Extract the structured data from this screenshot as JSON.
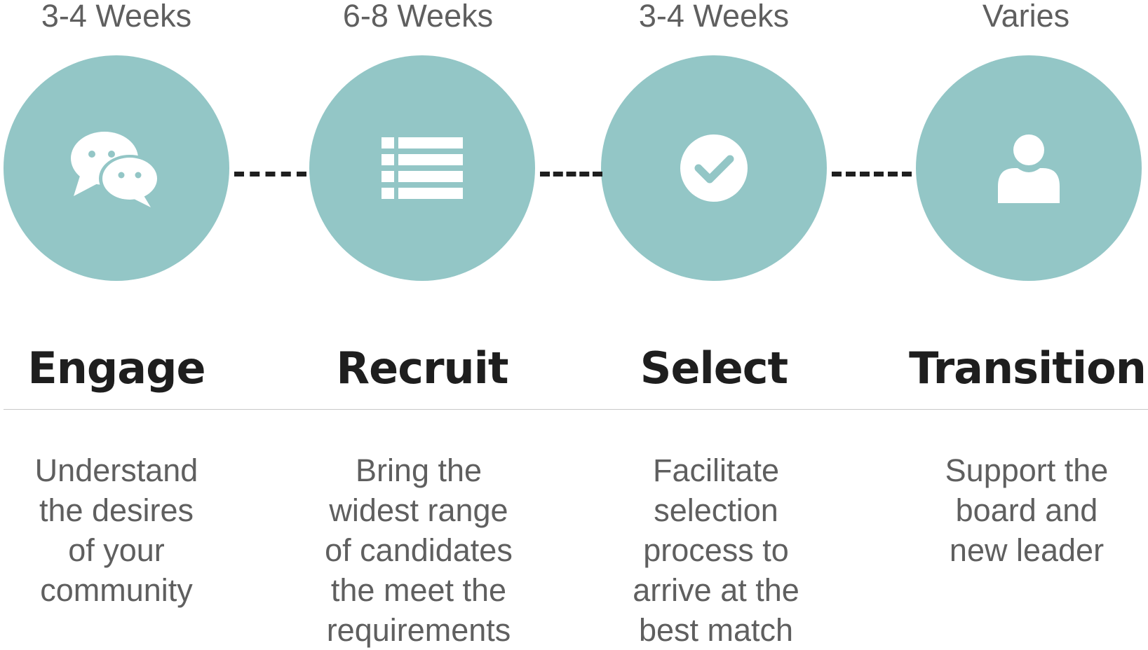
{
  "colors": {
    "circle_fill": "#93c6c6",
    "icon_fill": "#ffffff",
    "connector": "#1f1f1f",
    "duration_text": "#5f5f5f",
    "title_text": "#1e1e1e",
    "description_text": "#5f5f5f"
  },
  "steps": [
    {
      "duration": "3-4 Weeks",
      "icon": "chat-bubbles-icon",
      "title": "Engage",
      "description": "Understand\nthe desires\nof your\ncommunity"
    },
    {
      "duration": "6-8 Weeks",
      "icon": "list-icon",
      "title": "Recruit",
      "description": "Bring the\nwidest range\nof candidates\nthe meet the\nrequirements"
    },
    {
      "duration": "3-4 Weeks",
      "icon": "check-circle-icon",
      "title": "Select",
      "description": "Facilitate\nselection\nprocess to\narrive at the\nbest match"
    },
    {
      "duration": "Varies",
      "icon": "person-icon",
      "title": "Transition",
      "description": "Support the\nboard and\nnew leader"
    }
  ]
}
